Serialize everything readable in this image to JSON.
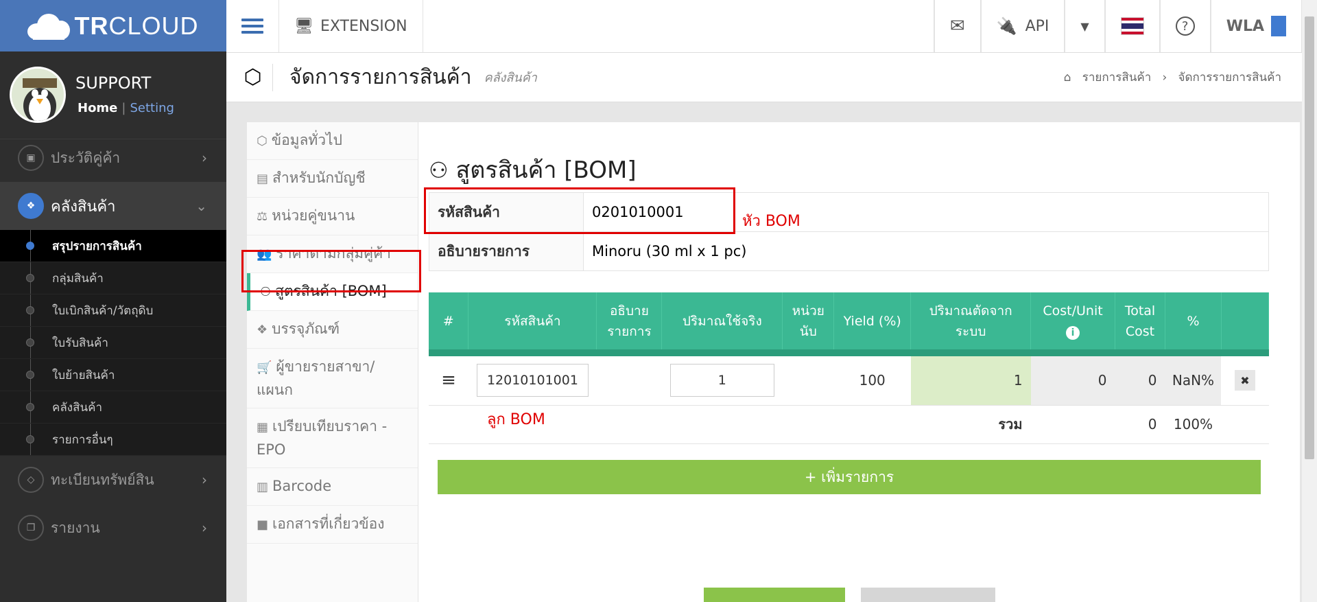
{
  "brand": {
    "bold": "TR",
    "light": "CLOUD"
  },
  "topbar": {
    "extension": "EXTENSION",
    "api": "API",
    "user": "WLA"
  },
  "profile": {
    "name": "SUPPORT",
    "home": "Home",
    "setting": "Setting"
  },
  "sidebar": {
    "history": "ประวัติคู่ค้า",
    "inventory": "คลังสินค้า",
    "subs": [
      "สรุปรายการสินค้า",
      "กลุ่มสินค้า",
      "ใบเบิกสินค้า/วัตถุดิบ",
      "ใบรับสินค้า",
      "ใบย้ายสินค้า",
      "คลังสินค้า",
      "รายการอื่นๆ"
    ],
    "assets": "ทะเบียนทรัพย์สิน",
    "report": "รายงาน"
  },
  "header": {
    "title": "จัดการรายการสินค้า",
    "subtitle": "คลังสินค้า",
    "crumb1": "รายการสินค้า",
    "crumb2": "จัดการรายการสินค้า"
  },
  "left_menu": [
    "ข้อมูลทั่วไป",
    "สำหรับนักบัญชี",
    "หน่วยคู่ขนาน",
    "ราคาตามกลุ่มคู่ค้า",
    "สูตรสินค้า [BOM]",
    "บรรจุภัณฑ์",
    "ผู้ขายรายสาขา/แผนก",
    "เปรียบเทียบราคา - EPO",
    "Barcode",
    "เอกสารที่เกี่ยวข้อง"
  ],
  "bom": {
    "title": "สูตรสินค้า [BOM]",
    "code_label": "รหัสสินค้า",
    "code_value": "0201010001",
    "desc_label": "อธิบายรายการ",
    "desc_value": "Minoru (30 ml x 1 pc)",
    "head_anno": "หัว BOM",
    "child_anno": "ลูก BOM",
    "columns": [
      "#",
      "รหัสสินค้า",
      "อธิบาย รายการ",
      "ปริมาณใช้จริง",
      "หน่วย นับ",
      "Yield (%)",
      "ปริมาณตัดจาก ระบบ",
      "Cost/Unit",
      "Total Cost",
      "%"
    ],
    "row": {
      "code": "12010101001",
      "qty": "1",
      "yield": "100",
      "sys_qty": "1",
      "cost_unit": "0",
      "total": "0",
      "pct": "NaN%"
    },
    "total_label": "รวม",
    "total_value": "0",
    "total_pct": "100%",
    "add_button": "+ เพิ่มรายการ"
  }
}
